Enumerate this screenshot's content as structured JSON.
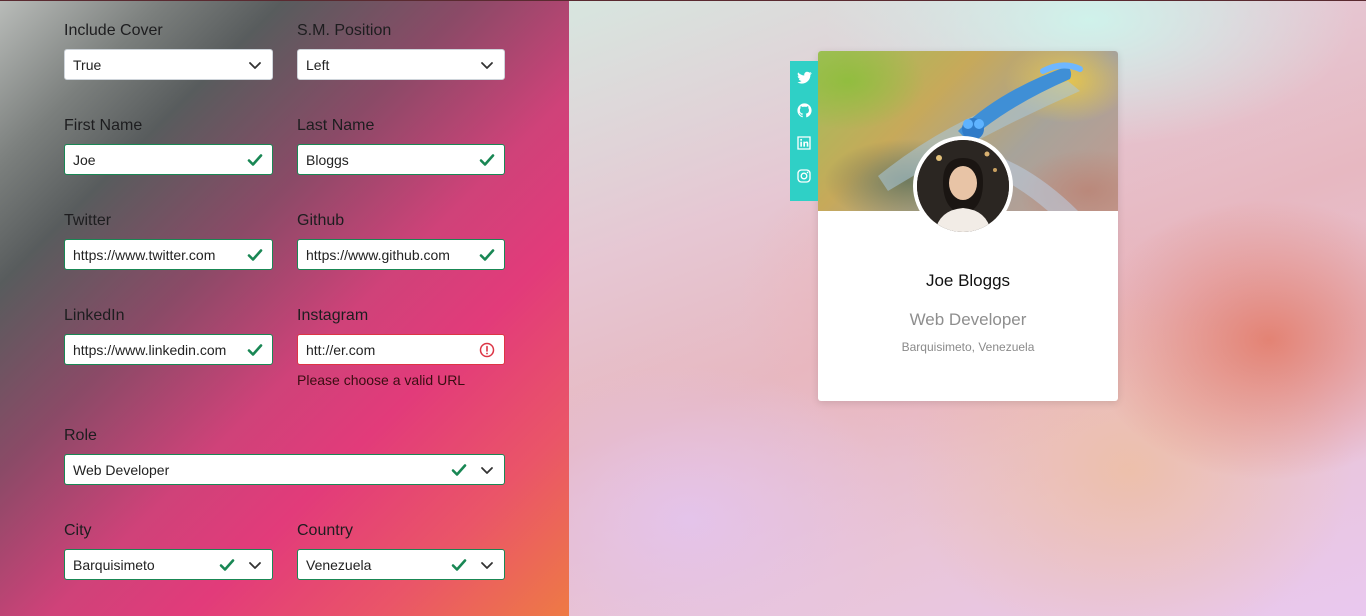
{
  "form": {
    "include_cover": {
      "label": "Include Cover",
      "value": "True"
    },
    "sm_position": {
      "label": "S.M. Position",
      "value": "Left"
    },
    "first_name": {
      "label": "First Name",
      "value": "Joe"
    },
    "last_name": {
      "label": "Last Name",
      "value": "Bloggs"
    },
    "twitter": {
      "label": "Twitter",
      "value": "https://www.twitter.com"
    },
    "github": {
      "label": "Github",
      "value": "https://www.github.com"
    },
    "linkedin": {
      "label": "LinkedIn",
      "value": "https://www.linkedin.com"
    },
    "instagram": {
      "label": "Instagram",
      "value": "htt://er.com",
      "error": "Please choose a valid URL"
    },
    "role": {
      "label": "Role",
      "value": "Web Developer"
    },
    "city": {
      "label": "City",
      "value": "Barquisimeto"
    },
    "country": {
      "label": "Country",
      "value": "Venezuela"
    }
  },
  "card": {
    "name": "Joe Bloggs",
    "role": "Web Developer",
    "location": "Barquisimeto, Venezuela",
    "social_icons": [
      "twitter-icon",
      "github-icon",
      "linkedin-icon",
      "instagram-icon"
    ]
  },
  "colors": {
    "valid": "#198754",
    "invalid": "#dc3545",
    "social_bar": "#2fd0c6"
  }
}
